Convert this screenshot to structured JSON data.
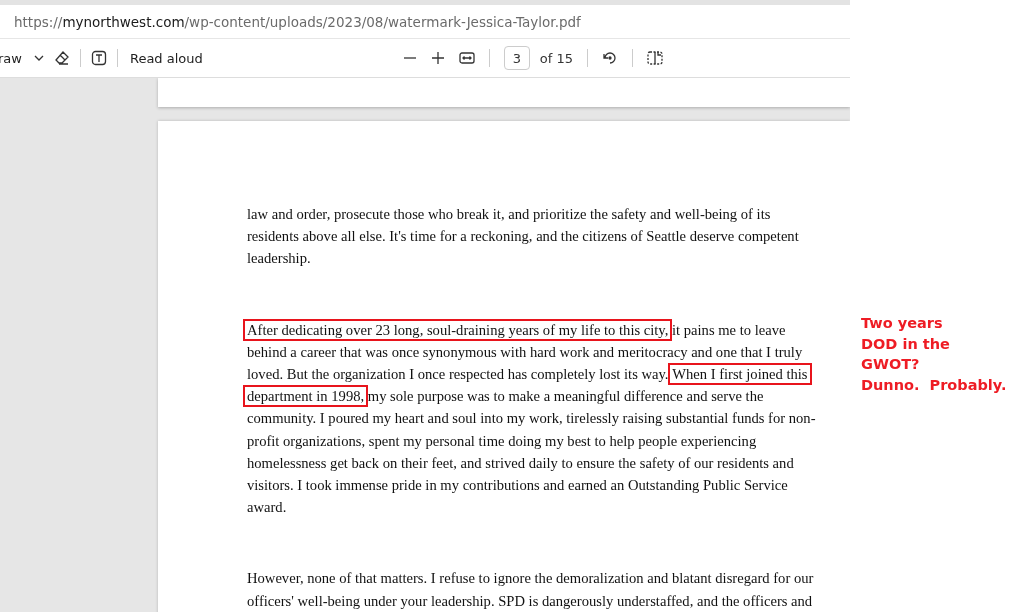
{
  "address_bar": {
    "scheme": "https://",
    "host": "mynorthwest.com",
    "path": "/wp-content/uploads/2023/08/watermark-Jessica-Taylor.pdf"
  },
  "toolbar": {
    "draw_label": "raw",
    "read_aloud": "Read aloud",
    "page_number": "3",
    "page_count": "of 15"
  },
  "document": {
    "paragraphs": [
      [
        [
          {
            "text": "law and order, prosecute those who break it, and prioritize the safety and well-being of its",
            "boxed": false
          }
        ],
        [
          {
            "text": "residents above all else. It's time for a reckoning, and the citizens of Seattle deserve competent",
            "boxed": false
          }
        ],
        [
          {
            "text": "leadership.",
            "boxed": false
          }
        ]
      ],
      [
        [
          {
            "text": "After dedicating over 23 long, soul-draining years of my life to this city,",
            "boxed": true
          },
          {
            "text": " it pains me to leave",
            "boxed": false
          }
        ],
        [
          {
            "text": "behind a career that was once synonymous with hard work and meritocracy and one that I truly",
            "boxed": false
          }
        ],
        [
          {
            "text": "loved. But the organization I once respected has completely lost its way. ",
            "boxed": false
          },
          {
            "text": "When I first joined this",
            "boxed": true
          }
        ],
        [
          {
            "text": "department in 1998,",
            "boxed": true
          },
          {
            "text": " my sole purpose was to make a meaningful difference and serve the",
            "boxed": false
          }
        ],
        [
          {
            "text": "community. I poured my heart and soul into my work, tirelessly raising substantial funds for non-",
            "boxed": false
          }
        ],
        [
          {
            "text": "profit organizations, spent my personal time doing my best to help people experiencing",
            "boxed": false
          }
        ],
        [
          {
            "text": "homelessness get back on their feet, and strived daily to ensure the safety of our residents and",
            "boxed": false
          }
        ],
        [
          {
            "text": "visitors. I took immense pride in my contributions and earned an Outstanding Public Service",
            "boxed": false
          }
        ],
        [
          {
            "text": "award.",
            "boxed": false
          }
        ]
      ],
      [
        [
          {
            "text": "However, none of that matters. I refuse to ignore the demoralization and blatant disregard for our",
            "boxed": false
          }
        ],
        [
          {
            "text": "officers' well-being under your leadership. SPD is dangerously understaffed, and the officers and",
            "boxed": false
          }
        ]
      ]
    ]
  },
  "annotation": {
    "lines": [
      "Two years",
      "DOD in the",
      "GWOT?",
      "Dunno.  Probably."
    ]
  }
}
